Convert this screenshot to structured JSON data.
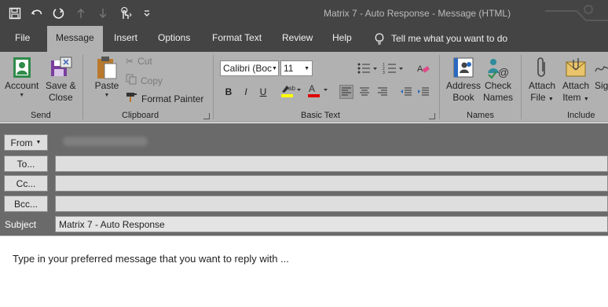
{
  "window": {
    "title": "Matrix 7 - Auto Response  -  Message (HTML)"
  },
  "tabs": [
    "File",
    "Message",
    "Insert",
    "Options",
    "Format Text",
    "Review",
    "Help"
  ],
  "tell_me": "Tell me what you want to do",
  "ribbon": {
    "send": {
      "group_label": "Send",
      "account_label": "Account",
      "save_close_line1": "Save &",
      "save_close_line2": "Close"
    },
    "clipboard": {
      "group_label": "Clipboard",
      "paste_label": "Paste",
      "cut_label": "Cut",
      "copy_label": "Copy",
      "format_painter_label": "Format Painter"
    },
    "basic_text": {
      "group_label": "Basic Text",
      "font_name": "Calibri (Boc",
      "font_size": "11",
      "bold": "B",
      "italic": "I",
      "underline": "U"
    },
    "names": {
      "group_label": "Names",
      "address_line1": "Address",
      "address_line2": "Book",
      "check_line1": "Check",
      "check_line2": "Names"
    },
    "include": {
      "group_label": "Include",
      "attach_file_line1": "Attach",
      "attach_file_line2": "File",
      "attach_item_line1": "Attach",
      "attach_item_line2": "Item",
      "signature_partial": "Sig"
    }
  },
  "fields": {
    "from_label": "From",
    "to_label": "To...",
    "cc_label": "Cc...",
    "bcc_label": "Bcc...",
    "subject_label": "Subject",
    "subject_value": "Matrix 7 - Auto Response"
  },
  "message_body": "Type in your preferred message that you want to reply with ...",
  "colors": {
    "titlebar": "#444444",
    "ribbon": "#b1b1b1",
    "header_area": "#6a6a6a",
    "highlight_yellow": "#ffff00",
    "font_red": "#e00000"
  }
}
